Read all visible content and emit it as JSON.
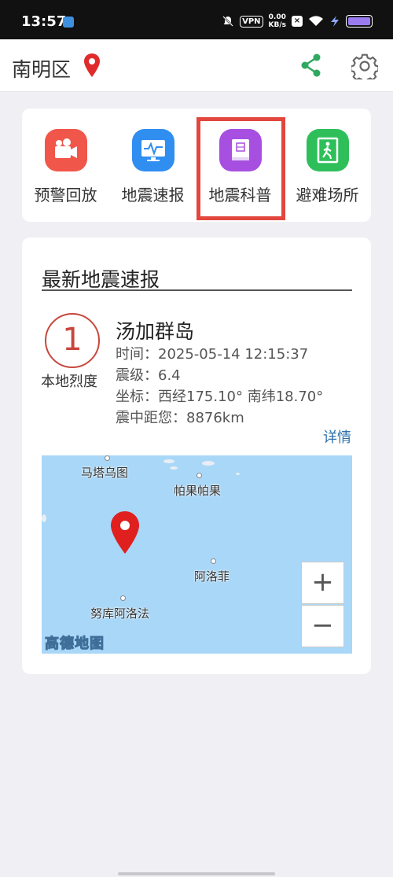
{
  "status_bar": {
    "time": "13:57",
    "vpn": "VPN",
    "speed_value": "0.00",
    "speed_unit": "KB/s",
    "x_badge": "×"
  },
  "header": {
    "location": "南明区"
  },
  "nav": {
    "items": [
      {
        "label": "预警回放",
        "icon": "video-camera-icon",
        "color": "#f0564a"
      },
      {
        "label": "地震速报",
        "icon": "monitor-pulse-icon",
        "color": "#2f8ef0"
      },
      {
        "label": "地震科普",
        "icon": "book-icon",
        "color": "#a64fe0"
      },
      {
        "label": "避难场所",
        "icon": "exit-door-icon",
        "color": "#2fbf5a"
      }
    ],
    "selected_index": 2
  },
  "quake": {
    "section_title": "最新地震速报",
    "intensity": "1",
    "intensity_label": "本地烈度",
    "place": "汤加群岛",
    "time_line": "时间：2025-05-14 12:15:37",
    "magnitude_line": "震级：6.4",
    "coord_line": "坐标：西经175.10° 南纬18.70°",
    "distance_line": "震中距您：8876km",
    "details_label": "详情"
  },
  "map": {
    "labels": [
      "马塔乌图",
      "帕果帕果",
      "阿洛菲",
      "努库阿洛法"
    ],
    "zoom_in": "+",
    "zoom_out": "−",
    "logo": "高德地图"
  },
  "colors": {
    "accent_red": "#e2463d",
    "link_blue": "#2b6fa8",
    "share_green": "#2fa860"
  }
}
